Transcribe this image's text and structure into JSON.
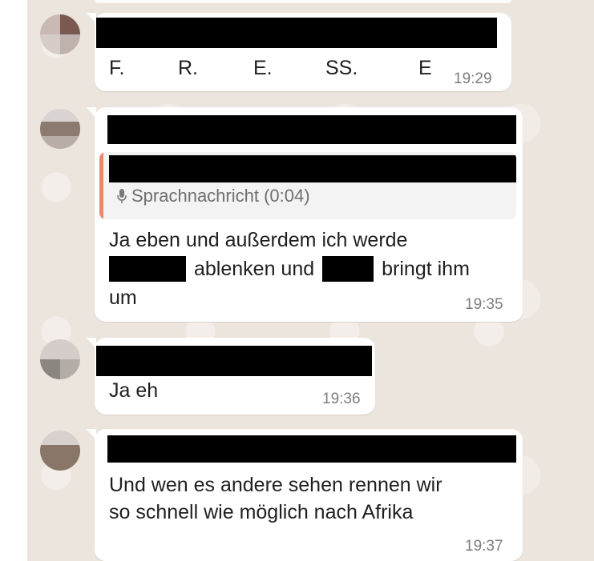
{
  "chat": {
    "messages": [
      {
        "letters": [
          "F.",
          "R.",
          "E.",
          "SS.",
          "E"
        ],
        "time": "19:29"
      },
      {
        "quote": {
          "voice_label": "Sprachnachricht (0:04)"
        },
        "line1": "Ja eben und außerdem ich werde",
        "line2_a": "ablenken und",
        "line2_b": "bringt ihm",
        "line3": "um",
        "time": "19:35"
      },
      {
        "text": "Ja eh",
        "time": "19:36"
      },
      {
        "line1": "Und wen es andere sehen rennen wir",
        "line2": "so schnell wie möglich nach Afrika",
        "time": "19:37"
      }
    ]
  },
  "colors": {
    "chat_background": "#ece5dd",
    "bubble": "#ffffff",
    "quote_accent": "#e8896a",
    "timestamp": "#7d7d7d"
  },
  "icons": {
    "voice_note": "microphone-icon"
  }
}
